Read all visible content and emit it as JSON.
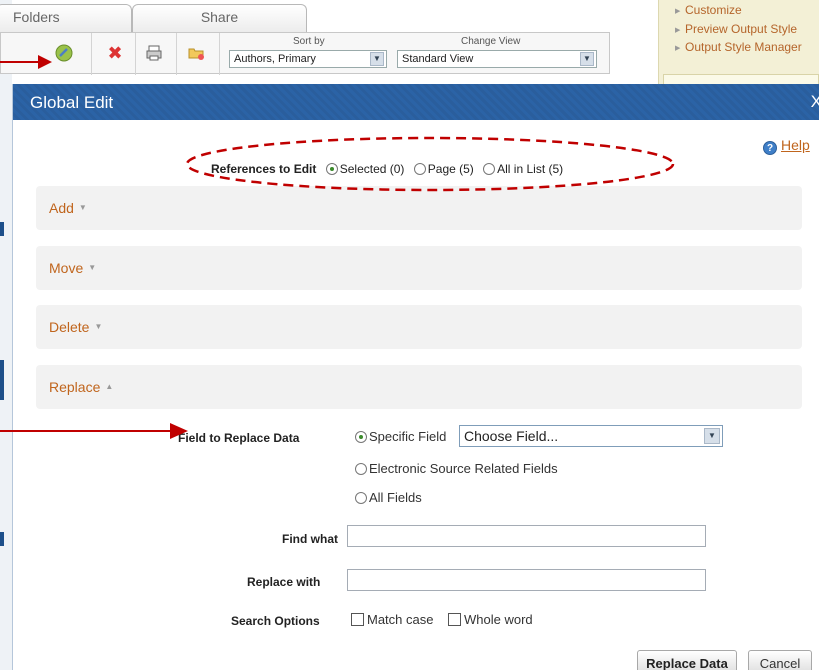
{
  "background": {
    "tabs": [
      "Folders",
      "Share"
    ],
    "sort_by_label": "Sort by",
    "sort_by_value": "Authors, Primary",
    "change_view_label": "Change View",
    "change_view_value": "Standard View",
    "right_links": [
      "Customize",
      "Preview Output Style",
      "Output Style Manager"
    ]
  },
  "modal": {
    "title": "Global Edit",
    "close_label": "X",
    "help_label": "Help",
    "references": {
      "label": "References to Edit",
      "options": [
        "Selected (0)",
        "Page (5)",
        "All in List (5)"
      ],
      "selected": "Selected (0)"
    },
    "sections": [
      "Add",
      "Move",
      "Delete",
      "Replace"
    ],
    "replace": {
      "field_label": "Field to Replace Data",
      "field_options": [
        "Specific Field",
        "Electronic Source Related Fields",
        "All Fields"
      ],
      "field_selected": "Specific Field",
      "choose_field": "Choose Field...",
      "find_label": "Find what",
      "find_value": "",
      "replace_label": "Replace with",
      "replace_value": "",
      "search_options_label": "Search Options",
      "checkboxes": [
        "Match case",
        "Whole word"
      ]
    },
    "buttons": {
      "replace_data": "Replace Data",
      "cancel": "Cancel"
    }
  },
  "colors": {
    "header": "#2b63a6",
    "accent_link": "#c0651d",
    "annotation": "#c00000",
    "section_bg": "#f2f2f2"
  }
}
